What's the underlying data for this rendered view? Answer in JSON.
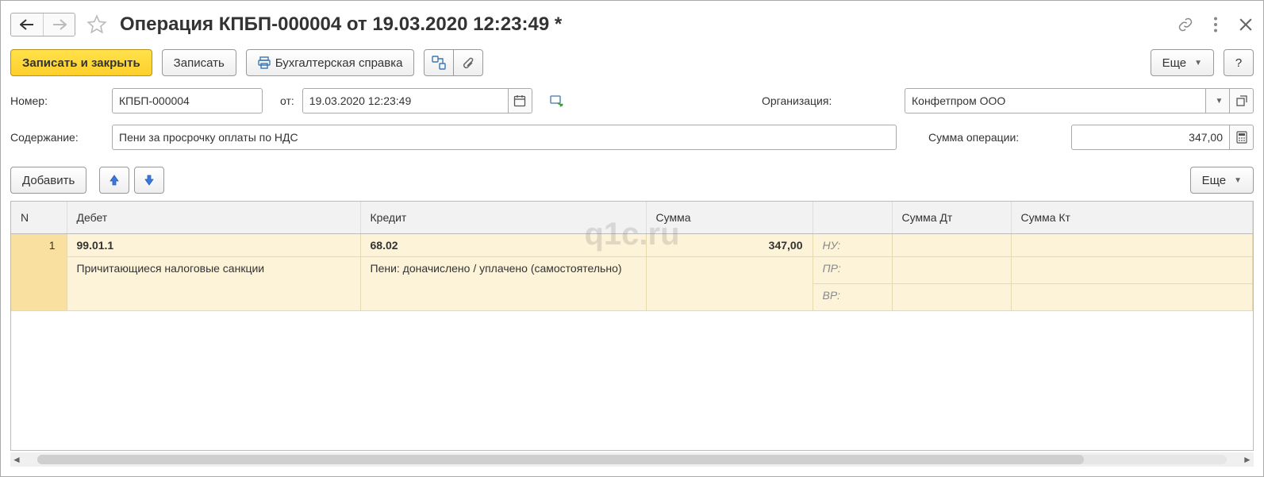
{
  "titlebar": {
    "title": "Операция КПБП-000004 от 19.03.2020 12:23:49 *"
  },
  "toolbar": {
    "save_close": "Записать и закрыть",
    "save": "Записать",
    "report": "Бухгалтерская справка",
    "more": "Еще",
    "help": "?"
  },
  "form": {
    "number_label": "Номер:",
    "number_value": "КПБП-000004",
    "date_label": "от:",
    "date_value": "19.03.2020 12:23:49",
    "org_label": "Организация:",
    "org_value": "Конфетпром ООО",
    "desc_label": "Содержание:",
    "desc_value": "Пени за просрочку оплаты по НДС",
    "sum_label": "Сумма операции:",
    "sum_value": "347,00"
  },
  "table_toolbar": {
    "add": "Добавить",
    "more": "Еще"
  },
  "table": {
    "headers": {
      "n": "N",
      "debit": "Дебет",
      "credit": "Кредит",
      "amount": "Сумма",
      "extra": "",
      "amount_dt": "Сумма Дт",
      "amount_kt": "Сумма Кт"
    },
    "rows": [
      {
        "n": "1",
        "debit_acct": "99.01.1",
        "debit_analytics": "Причитающиеся налоговые санкции",
        "credit_acct": "68.02",
        "credit_analytics": "Пени: доначислено / уплачено (самостоятельно)",
        "amount": "347,00",
        "extra_labels": [
          "НУ:",
          "ПР:",
          "ВР:"
        ]
      }
    ]
  },
  "watermark": "q1c.ru"
}
